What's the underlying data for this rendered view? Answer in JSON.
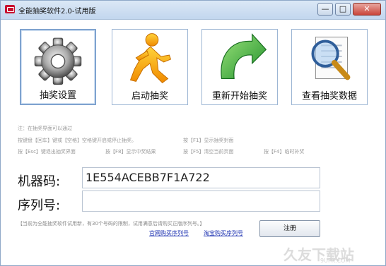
{
  "window": {
    "title": "全能抽奖软件2.0-试用版",
    "controls": {
      "minimize": "—",
      "maximize": "□",
      "close": "✕"
    }
  },
  "toolbar": {
    "tiles": [
      {
        "label": "抽奖设置",
        "icon": "gear-icon"
      },
      {
        "label": "启动抽奖",
        "icon": "running-man-icon"
      },
      {
        "label": "重新开始抽奖",
        "icon": "restart-arrow-icon"
      },
      {
        "label": "查看抽奖数据",
        "icon": "magnifier-document-icon"
      }
    ]
  },
  "hints": {
    "line1": "注：在抽奖界面可以通过",
    "line2a": "按键盘【回车】键或【空格】空格键开启或停止抽奖。",
    "line2b": "按【F1】显示抽奖封面",
    "line3a": "按【Esc】键退出抽奖界面",
    "line3b": "按【F8】显示中奖结果",
    "line3c": "按【F5】清空当前页面",
    "line3d": "按【F4】临时补奖"
  },
  "form": {
    "machine_code_label": "机器码:",
    "machine_code_value": "1E554ACEBB7F1A722",
    "serial_label": "序列号:",
    "serial_value": ""
  },
  "notice": "【当前为全能抽奖软件试用新，有30个号码的限制，试用满意后请购买正版序列号。】",
  "links": {
    "official": "官网购买序列号",
    "taobao": "淘宝购买序列号"
  },
  "register_button": "注册",
  "watermark": {
    "main": "久友下载站",
    "sub": "9UPK.COM"
  }
}
